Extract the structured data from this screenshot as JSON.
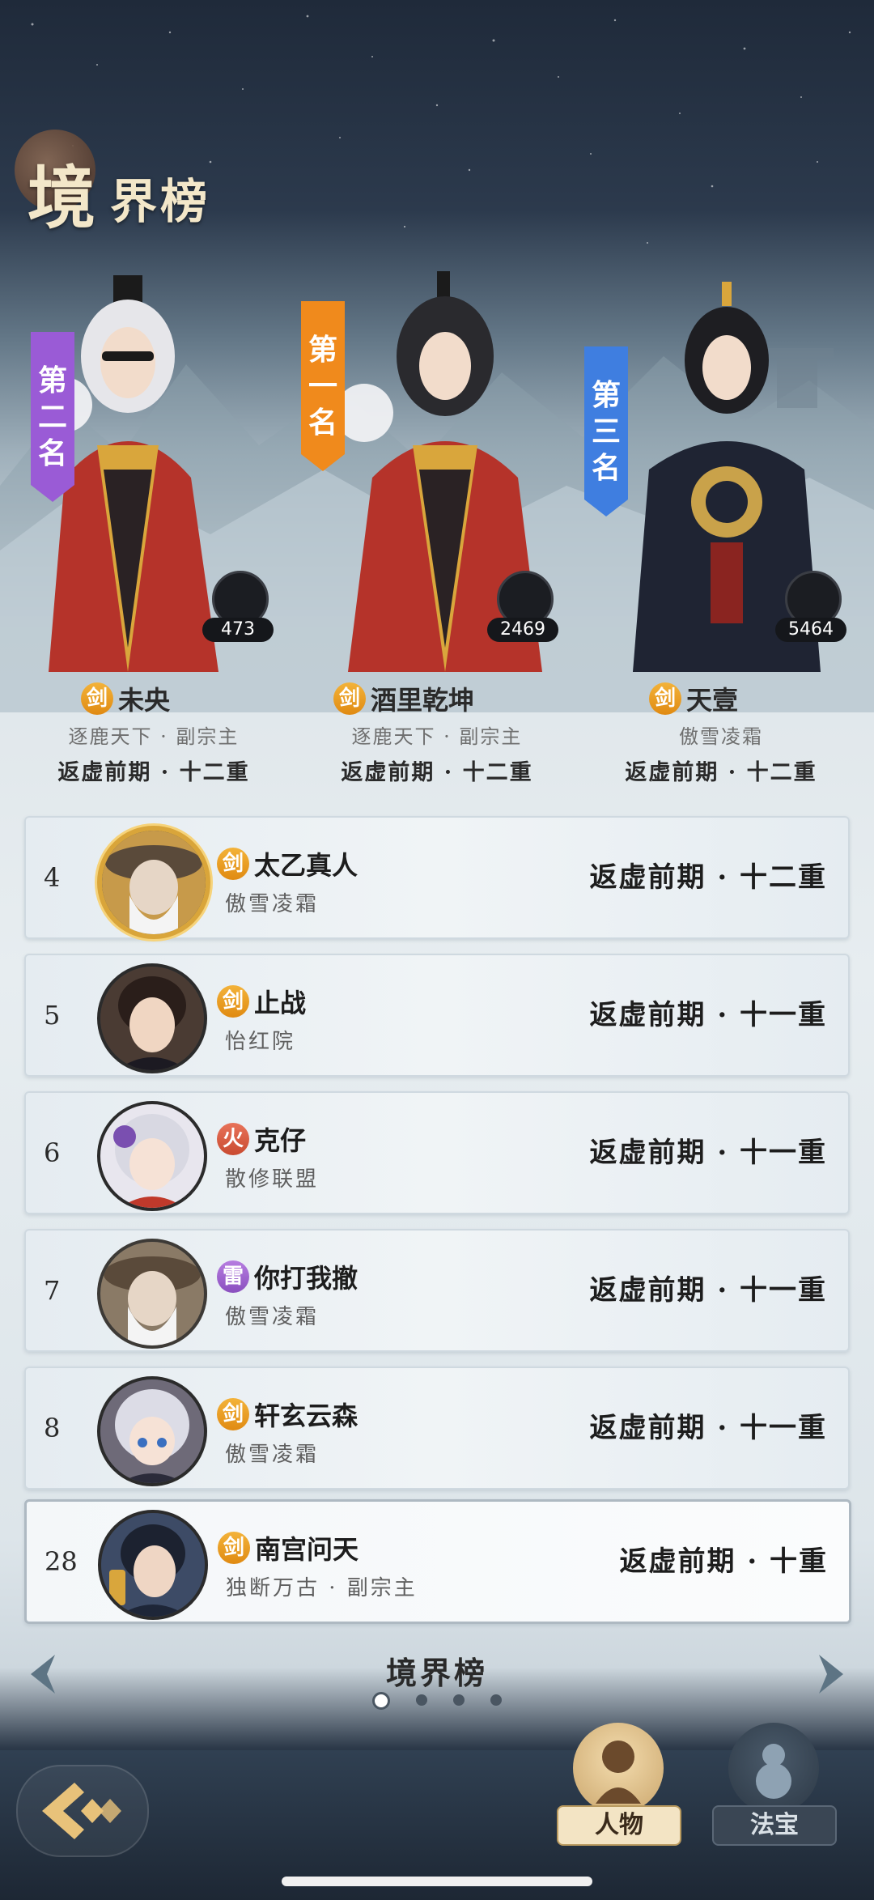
{
  "page_title": {
    "big": "境",
    "rest": "界榜"
  },
  "top_three": [
    {
      "rank_label": [
        "第",
        "二",
        "名"
      ],
      "banner_color": "#9a5bd6",
      "power": "473",
      "element": "剑",
      "name": "未央",
      "guild": "逐鹿天下 · 副宗主",
      "realm": "返虚前期 · 十二重"
    },
    {
      "rank_label": [
        "第",
        "一",
        "名"
      ],
      "banner_color": "#f08a1c",
      "power": "2469",
      "element": "剑",
      "name": "酒里乾坤",
      "guild": "逐鹿天下 · 副宗主",
      "realm": "返虚前期 · 十二重"
    },
    {
      "rank_label": [
        "第",
        "三",
        "名"
      ],
      "banner_color": "#3f7ee0",
      "power": "5464",
      "element": "剑",
      "name": "天壹",
      "guild": "傲雪凌霜",
      "realm": "返虚前期 · 十二重"
    }
  ],
  "ranking": [
    {
      "rank": "4",
      "element": "剑",
      "name": "太乙真人",
      "guild": "傲雪凌霜",
      "realm": "返虚前期 · 十二重"
    },
    {
      "rank": "5",
      "element": "剑",
      "name": "止战",
      "guild": "怡红院",
      "realm": "返虚前期 · 十一重"
    },
    {
      "rank": "6",
      "element": "火",
      "name": "克仔",
      "guild": "散修联盟",
      "realm": "返虚前期 · 十一重"
    },
    {
      "rank": "7",
      "element": "雷",
      "name": "你打我撤",
      "guild": "傲雪凌霜",
      "realm": "返虚前期 · 十一重"
    },
    {
      "rank": "8",
      "element": "剑",
      "name": "轩玄云森",
      "guild": "傲雪凌霜",
      "realm": "返虚前期 · 十一重"
    }
  ],
  "self_row": {
    "rank": "28",
    "element": "剑",
    "name": "南宫问天",
    "guild": "独断万古 · 副宗主",
    "realm": "返虚前期 · 十重"
  },
  "pager": {
    "title": "境界榜",
    "pages": 4,
    "current": 1
  },
  "bottom_tabs": {
    "character": "人物",
    "treasure": "法宝"
  },
  "colors": {
    "sword": "#e8971c",
    "fire": "#d2553a",
    "thunder": "#9a5bd0"
  }
}
